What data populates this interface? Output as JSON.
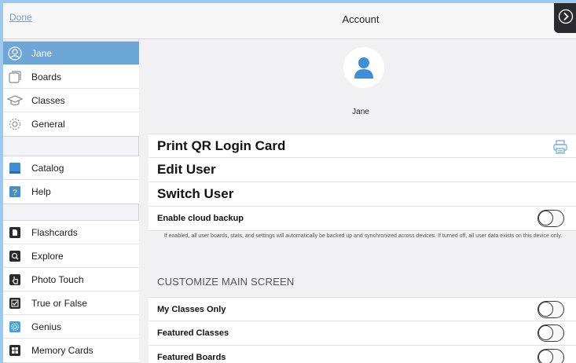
{
  "sidebar": {
    "done_label": "Done",
    "groups": [
      {
        "items": [
          {
            "label": "Jane",
            "icon": "user-circle-icon",
            "selected": true
          },
          {
            "label": "Boards",
            "icon": "boards-icon"
          },
          {
            "label": "Classes",
            "icon": "graduation-cap-icon"
          },
          {
            "label": "General",
            "icon": "gear-icon"
          }
        ]
      },
      {
        "items": [
          {
            "label": "Catalog",
            "icon": "book-icon"
          },
          {
            "label": "Help",
            "icon": "question-icon"
          }
        ]
      },
      {
        "items": [
          {
            "label": "Flashcards",
            "icon": "flashcards-icon"
          },
          {
            "label": "Explore",
            "icon": "explore-icon"
          },
          {
            "label": "Photo Touch",
            "icon": "hand-touch-icon"
          },
          {
            "label": "True or False",
            "icon": "checkbox-icon"
          },
          {
            "label": "Genius",
            "icon": "genius-icon"
          },
          {
            "label": "Memory Cards",
            "icon": "memory-cards-icon"
          }
        ]
      }
    ]
  },
  "header": {
    "title": "Account"
  },
  "profile": {
    "name": "Jane"
  },
  "actions": {
    "print_qr": "Print QR Login Card",
    "edit_user": "Edit User",
    "switch_user": "Switch User"
  },
  "cloud": {
    "label": "Enable cloud backup",
    "enabled": false,
    "note": "If enabled, all user boards, stats, and settings will automatically be backed up and synchronized across devices. If turned off, all user data exists on this device only."
  },
  "customize": {
    "header": "CUSTOMIZE MAIN SCREEN",
    "options": [
      {
        "label": "My Classes Only",
        "enabled": false
      },
      {
        "label": "Featured Classes",
        "enabled": false
      },
      {
        "label": "Featured Boards",
        "enabled": false
      }
    ]
  },
  "colors": {
    "selected": "#6ea6d8",
    "link": "#6e9cd0",
    "accent_icon": "#3f8fd6"
  }
}
